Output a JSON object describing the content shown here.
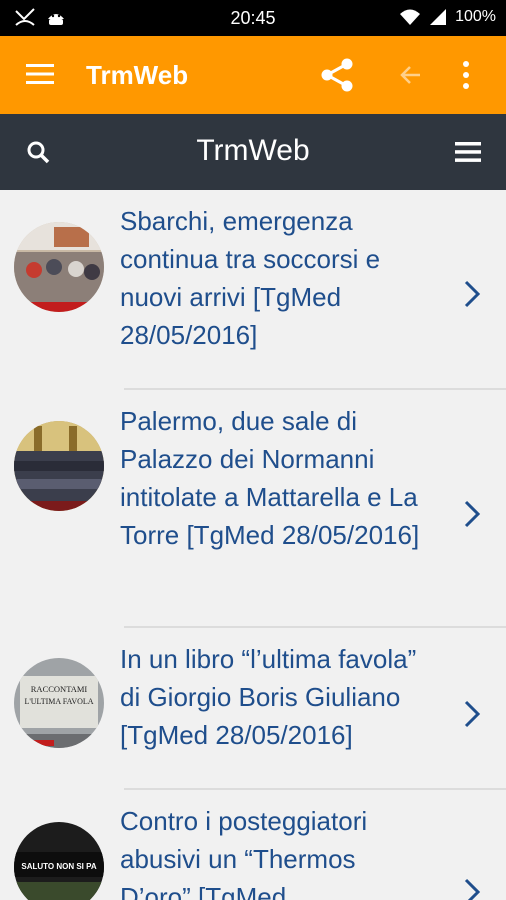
{
  "status_bar": {
    "time": "20:45",
    "battery": "100%"
  },
  "app_bar": {
    "title": "TrmWeb"
  },
  "sub_header": {
    "title": "TrmWeb"
  },
  "news": [
    {
      "title": "Sbarchi, emergenza continua tra soccorsi e nuovi arrivi [TgMed 28/05/2016]"
    },
    {
      "title": "Palermo, due sale di Palazzo dei Normanni intitolate a Mattarella e La Torre [TgMed 28/05/2016]"
    },
    {
      "title": "In un libro “l’ultima favola” di Giorgio Boris Giuliano [TgMed 28/05/2016]"
    },
    {
      "title": "Contro i posteggiatori abusivi un “Thermos D’oro” [TgMed"
    }
  ],
  "thumb_texts": {
    "book": "RACCONTAMI L'ULTIMA FAVOLA",
    "thermos": "SALUTO NON SI PA"
  },
  "colors": {
    "accent": "#ff9800",
    "header": "#2f363f",
    "link": "#1f4e8c"
  }
}
